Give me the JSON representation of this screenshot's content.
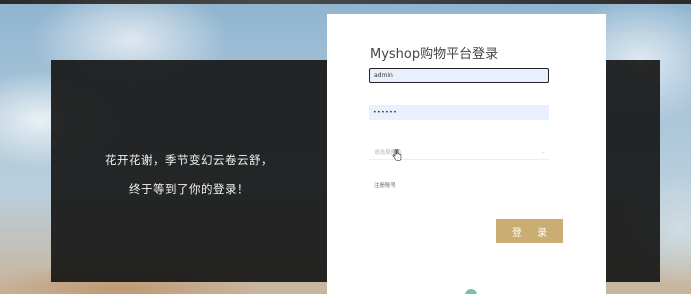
{
  "slogan": {
    "line1": "花开花谢，季节变幻云卷云舒，",
    "line2": "终于等到了你的登录！"
  },
  "login": {
    "title": "Myshop购物平台登录",
    "username_value": "admin",
    "password_value": "••••••",
    "select_placeholder": "请选择角色",
    "register_link": "注册账号",
    "submit_label": "登 录"
  },
  "colors": {
    "button": "#c9ad72",
    "autofill": "#e8f0fe",
    "panel": "#181818"
  },
  "icons": {
    "chevron": "chevron-down-icon",
    "cursor": "hand-cursor-icon"
  }
}
